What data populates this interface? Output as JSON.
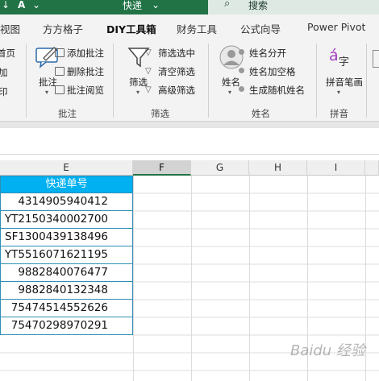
{
  "titlebar": {
    "title": "快递",
    "search_placeholder": "搜索",
    "quick_access": [
      "↓",
      "A",
      "⌄"
    ]
  },
  "tabs": [
    "视图",
    "方方格子",
    "DIY工具箱",
    "财务工具",
    "公式向导",
    "Power Pivot"
  ],
  "active_tab": "DIY工具箱",
  "ribbon": {
    "left_cut": [
      "首页",
      "加",
      "印"
    ],
    "annotation": {
      "big_button": "批注",
      "items": [
        "添加批注",
        "删除批注",
        "批注阅览"
      ],
      "group": "批注"
    },
    "filter": {
      "big_button": "筛选",
      "items": [
        "筛选选中",
        "清空筛选",
        "高级筛选"
      ],
      "group": "筛选"
    },
    "name": {
      "big_button": "姓名",
      "items": [
        "姓名分开",
        "姓名加空格",
        "生成随机姓名"
      ],
      "group": "姓名"
    },
    "pinyin": {
      "big_button": "拼音笔画",
      "group": "拼音"
    }
  },
  "sheet": {
    "columns": [
      "E",
      "F",
      "G",
      "H",
      "I"
    ],
    "selected_column": "F",
    "header_cell": "快递单号",
    "values": [
      "4314905940412",
      "YT2150340002700",
      "SF1300439138496",
      "YT5516071621195",
      "9882840076477",
      "9882840132348",
      "75474514552626",
      "75470298970291"
    ]
  },
  "watermark": "Baidu 经验",
  "colors": {
    "excel_green": "#217346",
    "header_fill": "#00b0f0"
  }
}
